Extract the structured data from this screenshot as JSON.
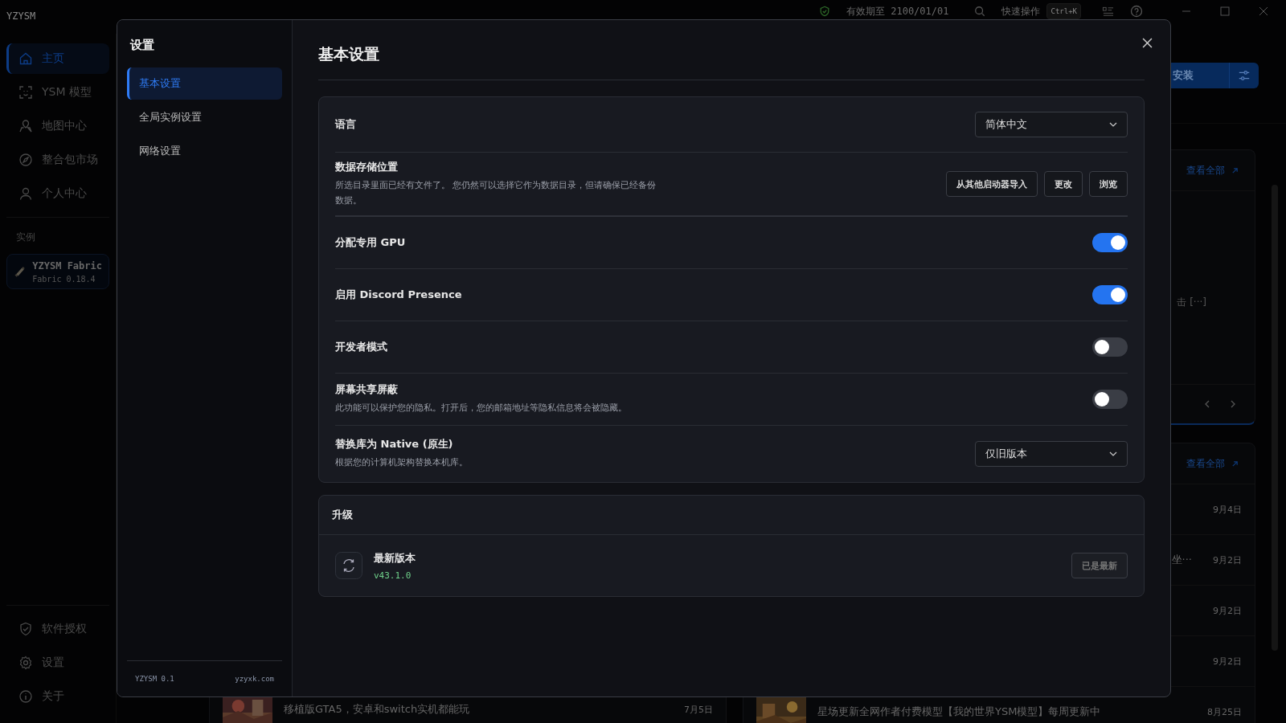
{
  "app": {
    "title": "YZYSM",
    "license": "有效期至 2100/01/01",
    "quick_action": "快速操作",
    "shortcut": "Ctrl+K"
  },
  "sidebar": {
    "items": [
      {
        "label": "主页",
        "selected": true
      },
      {
        "label": "YSM 模型",
        "selected": false
      },
      {
        "label": "地图中心",
        "selected": false
      },
      {
        "label": "整合包市场",
        "selected": false
      },
      {
        "label": "个人中心",
        "selected": false
      }
    ],
    "section": "实例",
    "instance": {
      "name": "YZYSM Fabric",
      "version": "Fabric 0.18.4"
    },
    "footer_items": [
      "软件授权",
      "设置",
      "关于"
    ]
  },
  "background": {
    "install_button": "安装",
    "card_1": {
      "link": "查看全部",
      "snippet": "击 [···]"
    },
    "card_2": {
      "link": "查看全部",
      "rows": [
        {
          "text": "",
          "date": "9月4日"
        },
        {
          "text": "坐···",
          "date": "9月2日"
        },
        {
          "text": "",
          "date": "9月2日"
        },
        {
          "text": "",
          "date": "9月2日"
        },
        {
          "text": "星场更新全网作者付费模型【我的世界YSM模型】每周更新中",
          "date": "8月25日"
        }
      ]
    },
    "left_row": {
      "text": "移植版GTA5，安卓和switch实机都能玩",
      "date": "7月5日"
    }
  },
  "settings": {
    "title": "设置",
    "nav": [
      {
        "label": "基本设置",
        "selected": true
      },
      {
        "label": "全局实例设置",
        "selected": false
      },
      {
        "label": "网络设置",
        "selected": false
      }
    ],
    "version": "YZYSM 0.1",
    "site": "yzyxk.com",
    "heading": "基本设置",
    "rows": [
      {
        "kind": "select",
        "title": "语言",
        "value": "简体中文"
      },
      {
        "kind": "buttons",
        "title": "数据存储位置",
        "description": "所选目录里面已经有文件了。 您仍然可以选择它作为数据目录，但请确保已经备份数据。",
        "buttons": [
          "从其他启动器导入",
          "更改",
          "浏览"
        ]
      },
      {
        "kind": "toggle",
        "title": "分配专用 GPU",
        "on": true
      },
      {
        "kind": "toggle",
        "title": "启用 Discord Presence",
        "on": true
      },
      {
        "kind": "toggle",
        "title": "开发者模式",
        "on": false
      },
      {
        "kind": "toggle",
        "title": "屏幕共享屏蔽",
        "description": "此功能可以保护您的隐私。打开后，您的邮箱地址等隐私信息将会被隐藏。",
        "on": false
      },
      {
        "kind": "select",
        "title": "替换库为 Native (原生)",
        "description": "根据您的计算机架构替换本机库。",
        "value": "仅旧版本"
      }
    ],
    "upgrade": {
      "title": "升级",
      "label": "最新版本",
      "version": "v43.1.0",
      "button": "已是最新",
      "disabled": true
    }
  }
}
